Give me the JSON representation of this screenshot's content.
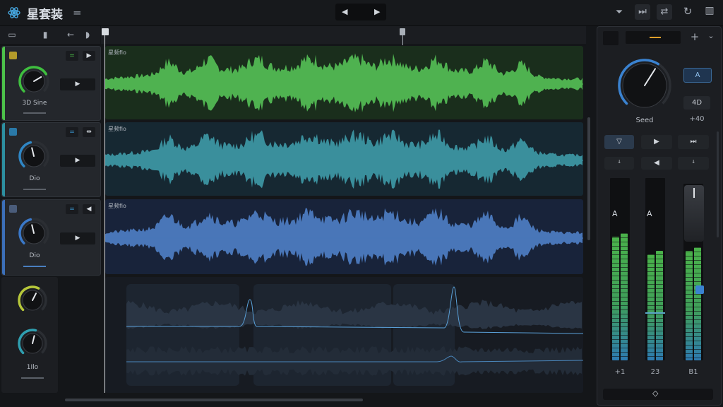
{
  "app": {
    "title": "星套装",
    "logo_icon": "atom-logo-icon",
    "menu_icon": "hamburger-icon"
  },
  "transport": {
    "prev_icon": "◀",
    "next_icon": "▶"
  },
  "top_right": {
    "icons": [
      "filter-icon",
      "skip-icon",
      "swap-icon",
      "sync-icon",
      "mixer-bars-icon"
    ]
  },
  "header_toolbar": {
    "icons": [
      "comment-icon",
      "mic-icon",
      "back-arrow-icon",
      "speaker-icon"
    ]
  },
  "tracks": [
    {
      "label": "3D Sine",
      "lane_name": "星频fio",
      "color": "#4cc24a",
      "wave_color": "#4fb250",
      "bg": "#1a2e1c",
      "knob_color": "#3fbf3f",
      "knob_level": 0.72,
      "play_icon": "▶"
    },
    {
      "label": "Dio",
      "lane_name": "星频fio",
      "color": "#2d8fa0",
      "wave_color": "#3a8f9c",
      "bg": "#162832",
      "knob_color": "#2f86c4",
      "knob_level": 0.45,
      "play_icon": "▶"
    },
    {
      "label": "Dio",
      "lane_name": "星频fio",
      "color": "#3c6fb8",
      "wave_color": "#4976b8",
      "bg": "#18233a",
      "knob_color": "#3a78c8",
      "knob_level": 0.45,
      "play_icon": "▶"
    }
  ],
  "bottom_strip": {
    "label": "1Ilo",
    "knob1_color": "#b6c73a",
    "knob1_level": 0.6,
    "knob2_color": "#2f9fb0",
    "knob2_level": 0.55
  },
  "right_panel": {
    "main_knob_label": "Seed",
    "main_knob_color": "#3a82d0",
    "main_knob_level": 0.62,
    "btn_a": "A",
    "btn_4d": "4D",
    "val_40": "+40",
    "transport_row1": [
      "▽",
      "▶",
      "⏭"
    ],
    "transport_row2": [
      "ꜜ",
      "◀",
      "ꜜ"
    ],
    "meters": [
      {
        "label": "+1",
        "level": 0.68,
        "peak_marker": "A"
      },
      {
        "label": "23",
        "level": 0.58,
        "peak_marker": "A"
      },
      {
        "label": "B1",
        "level": 0.62,
        "peak_marker": ""
      }
    ],
    "footer_icon": "◇"
  },
  "colors": {
    "accent_green": "#4cc24a",
    "accent_teal": "#2d8fa0",
    "accent_blue": "#3c6fb8"
  }
}
